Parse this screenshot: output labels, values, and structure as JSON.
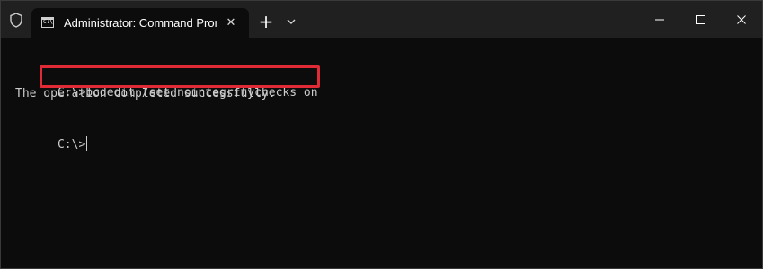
{
  "titlebar": {
    "tab_title": "Administrator: Command Prompt",
    "tab_icon_glyph": "C:\\",
    "close_tab_symbol": "✕",
    "new_tab_symbol": "+"
  },
  "console": {
    "prompt1": "C:\\>",
    "command1": "bcdedit /set nointegritychecks on",
    "output1": "The operation completed successfully.",
    "prompt2": "C:\\>"
  },
  "colors": {
    "titlebar_bg": "#202020",
    "console_bg": "#0c0c0c",
    "console_text": "#cccccc",
    "highlight_border": "#e02a36"
  },
  "icons": {
    "shield": "shield-icon",
    "tab": "cmd-icon",
    "dropdown": "chevron-down-icon",
    "minimize": "minimize-icon",
    "maximize": "maximize-icon",
    "close": "close-icon"
  }
}
